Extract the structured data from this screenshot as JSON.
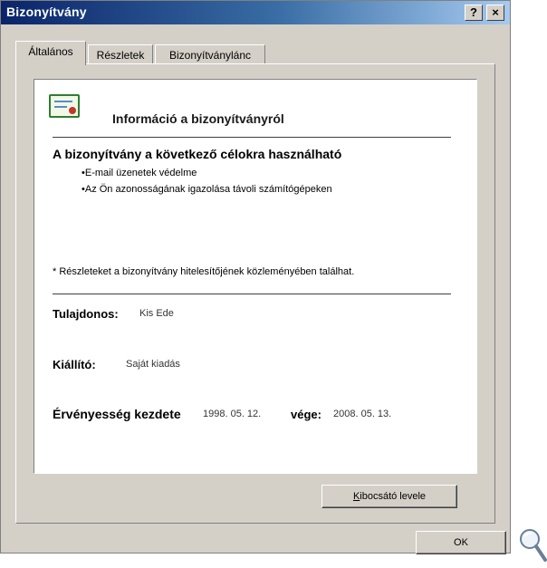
{
  "window": {
    "title": "Bizonyítvány"
  },
  "title_buttons": {
    "help": "?",
    "close": "×"
  },
  "tabs": [
    {
      "label": "Általános",
      "active": true
    },
    {
      "label": "Részletek",
      "active": false
    },
    {
      "label": "Bizonyítványlánc",
      "active": false
    }
  ],
  "general": {
    "icon": "certificate-icon",
    "info_heading": "Információ a bizonyítványról",
    "purposes_title": "A bizonyítvány a következő célokra használható",
    "purposes": [
      "•E-mail üzenetek védelme",
      "•Az Ön azonosságának igazolása távoli számítógépeken"
    ],
    "footnote": "* Részleteket a bizonyítvány hitelesítőjének közleményében találhat.",
    "owner_label": "Tulajdonos:",
    "owner_value": "Kis Ede",
    "issuer_label": "Kiállító:",
    "issuer_value": "Saját kiadás",
    "valid_from_label": "Érvényesség kezdete",
    "valid_from_value": "1998. 05. 12.",
    "valid_to_label": "vége:",
    "valid_to_value": "2008. 05. 13."
  },
  "buttons": {
    "statement_first": "K",
    "statement_rest": "ibocsátó levele",
    "ok": "OK"
  },
  "colors": {
    "title_start": "#0a246a",
    "title_end": "#a6caf0",
    "dialog_face": "#d4d0c8"
  },
  "magnifier": "magnifier-icon"
}
